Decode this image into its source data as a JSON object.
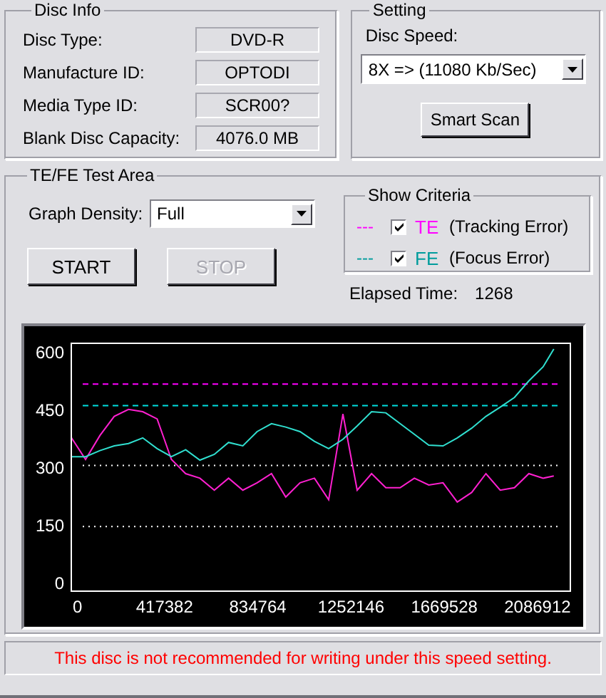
{
  "disc_info": {
    "title": "Disc Info",
    "fields": [
      {
        "label": "Disc Type:",
        "value": "DVD-R"
      },
      {
        "label": "Manufacture ID:",
        "value": "OPTODI"
      },
      {
        "label": "Media Type ID:",
        "value": "SCR00?"
      },
      {
        "label": "Blank Disc Capacity:",
        "value": "4076.0 MB"
      }
    ]
  },
  "setting": {
    "title": "Setting",
    "speed_label": "Disc Speed:",
    "speed": "8X => (11080 Kb/Sec)",
    "smart_scan": "Smart Scan"
  },
  "test_area": {
    "title": "TE/FE Test Area",
    "density_label": "Graph Density:",
    "density": "Full",
    "buttons": [
      {
        "label": "START",
        "disabled": false
      },
      {
        "label": "STOP",
        "disabled": true
      }
    ],
    "criteria": {
      "title": "Show Criteria",
      "items": [
        {
          "marker": "---",
          "checked": true,
          "code": "TE",
          "desc": "(Tracking Error)",
          "color": "#ff00ff"
        },
        {
          "marker": "---",
          "checked": true,
          "code": "FE",
          "desc": "(Focus Error)",
          "color": "#009c9c"
        }
      ]
    },
    "elapsed_label": "Elapsed Time:",
    "elapsed": "1268",
    "chart_data": {
      "type": "line",
      "xlim": [
        0,
        2234000
      ],
      "ylim": [
        -20,
        625
      ],
      "xticks": [
        0,
        417382,
        834764,
        1252146,
        1669528,
        2086912
      ],
      "yticks": [
        0,
        150,
        300,
        450,
        600
      ],
      "x": [
        0,
        64000,
        128000,
        192000,
        256000,
        320000,
        384000,
        448000,
        512000,
        576000,
        640000,
        704000,
        768000,
        832000,
        896000,
        960000,
        1024000,
        1088000,
        1152000,
        1216000,
        1280000,
        1344000,
        1408000,
        1472000,
        1536000,
        1600000,
        1664000,
        1728000,
        1792000,
        1856000,
        1920000,
        1984000,
        2048000,
        2112000,
        2160000
      ],
      "series": [
        {
          "color": "#ff20d0",
          "values": [
            380,
            323,
            385,
            435,
            453,
            447,
            428,
            323,
            286,
            274,
            243,
            274,
            243,
            262,
            286,
            225,
            262,
            274,
            218,
            441,
            243,
            286,
            249,
            249,
            274,
            256,
            262,
            212,
            237,
            286,
            243,
            249,
            286,
            274,
            280
          ]
        },
        {
          "color": "#30e0d0",
          "values": [
            330,
            330,
            346,
            358,
            364,
            379,
            351,
            330,
            348,
            321,
            336,
            367,
            358,
            395,
            416,
            407,
            395,
            370,
            351,
            375,
            410,
            447,
            444,
            416,
            388,
            360,
            358,
            379,
            404,
            435,
            459,
            484,
            527,
            564,
            610
          ]
        }
      ],
      "ref_lines": [
        {
          "axis": "y",
          "value": 519,
          "color": "#ff00ff"
        },
        {
          "axis": "y",
          "value": 463,
          "color": "#00e0e0"
        },
        {
          "axis": "y",
          "value": 307,
          "color": "#ffffff"
        },
        {
          "axis": "y",
          "value": 148,
          "color": "#ffffff"
        }
      ]
    }
  },
  "status": {
    "message": "This disc is not recommended for writing under this speed setting."
  }
}
